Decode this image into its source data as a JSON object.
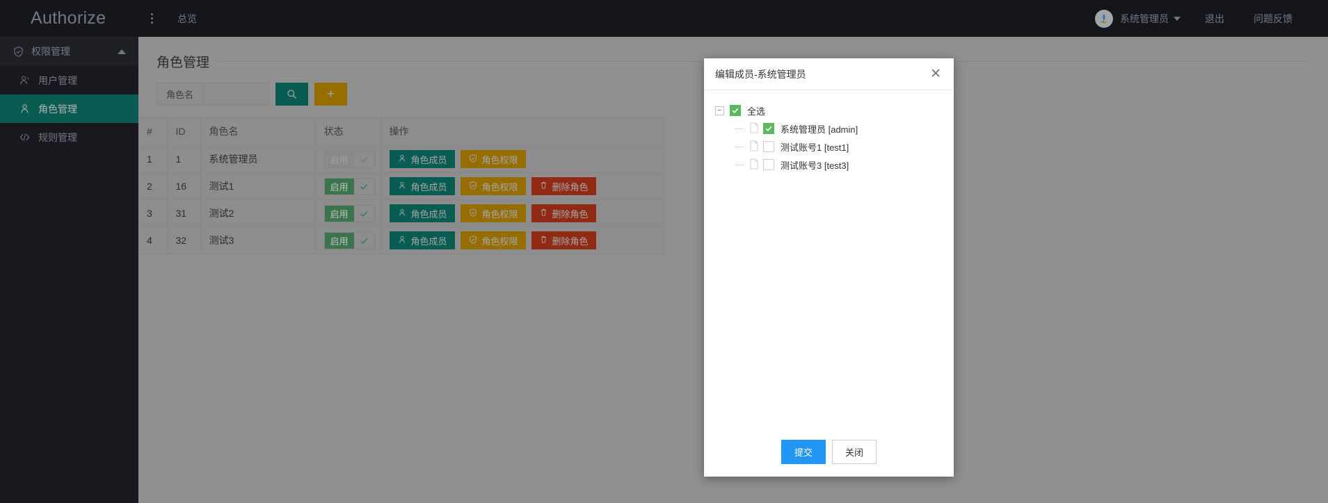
{
  "topbar": {
    "brand": "Authorize",
    "kebab_icon": "kebab-menu-icon",
    "overview": "总览",
    "avatar_icon": "user-avatar-icon",
    "user_name": "系统管理员",
    "logout": "退出",
    "feedback": "问题反馈"
  },
  "sidebar": {
    "group": {
      "label": "权限管理",
      "icon": "shield-check-icon",
      "arrow": "chevron-up-icon"
    },
    "items": [
      {
        "label": "用户管理",
        "icon": "users-icon",
        "active": false
      },
      {
        "label": "角色管理",
        "icon": "user-icon",
        "active": true
      },
      {
        "label": "规则管理",
        "icon": "code-icon",
        "active": false
      }
    ]
  },
  "main": {
    "page_title": "角色管理",
    "search": {
      "addon_label": "角色名",
      "value": "",
      "placeholder": "",
      "search_icon": "search-icon",
      "add_icon": "plus-icon"
    },
    "table": {
      "columns": [
        "#",
        "ID",
        "角色名",
        "状态",
        "操作"
      ],
      "rows": [
        {
          "num": "1",
          "id": "1",
          "name": "系统管理员",
          "state_label": "启用",
          "state_enabled": true,
          "state_disabled_ui": true,
          "ops": [
            {
              "label": "角色成员",
              "kind": "member",
              "icon": "user-icon"
            },
            {
              "label": "角色权限",
              "kind": "perm",
              "icon": "shield-check-icon"
            }
          ]
        },
        {
          "num": "2",
          "id": "16",
          "name": "测试1",
          "state_label": "启用",
          "state_enabled": true,
          "state_disabled_ui": false,
          "ops": [
            {
              "label": "角色成员",
              "kind": "member",
              "icon": "user-icon"
            },
            {
              "label": "角色权限",
              "kind": "perm",
              "icon": "shield-check-icon"
            },
            {
              "label": "删除角色",
              "kind": "del",
              "icon": "trash-icon"
            }
          ]
        },
        {
          "num": "3",
          "id": "31",
          "name": "测试2",
          "state_label": "启用",
          "state_enabled": true,
          "state_disabled_ui": false,
          "ops": [
            {
              "label": "角色成员",
              "kind": "member",
              "icon": "user-icon"
            },
            {
              "label": "角色权限",
              "kind": "perm",
              "icon": "shield-check-icon"
            },
            {
              "label": "删除角色",
              "kind": "del",
              "icon": "trash-icon"
            }
          ]
        },
        {
          "num": "4",
          "id": "32",
          "name": "测试3",
          "state_label": "启用",
          "state_enabled": true,
          "state_disabled_ui": false,
          "ops": [
            {
              "label": "角色成员",
              "kind": "member",
              "icon": "user-icon"
            },
            {
              "label": "角色权限",
              "kind": "perm",
              "icon": "shield-check-icon"
            },
            {
              "label": "删除角色",
              "kind": "del",
              "icon": "trash-icon"
            }
          ]
        }
      ]
    }
  },
  "modal": {
    "title": "编辑成员-系统管理员",
    "close_icon": "close-icon",
    "tree": {
      "root": {
        "label": "全选",
        "checked": true,
        "expander": "−"
      },
      "children": [
        {
          "label": "系统管理员 [admin]",
          "checked": true,
          "icon": "document-icon"
        },
        {
          "label": "测试账号1 [test1]",
          "checked": false,
          "icon": "document-icon"
        },
        {
          "label": "测试账号3 [test3]",
          "checked": false,
          "icon": "document-icon"
        }
      ]
    },
    "submit_label": "提交",
    "close_label": "关闭"
  },
  "colors": {
    "accent_teal": "#0b7b6c",
    "accent_gold": "#c89200",
    "danger_red": "#c0391b",
    "primary_blue": "#2196f3",
    "toggle_green": "#4f9d69",
    "check_green": "#5cb85c",
    "sidebar_dark": "#202128",
    "topbar_dark": "#1d1e26"
  }
}
